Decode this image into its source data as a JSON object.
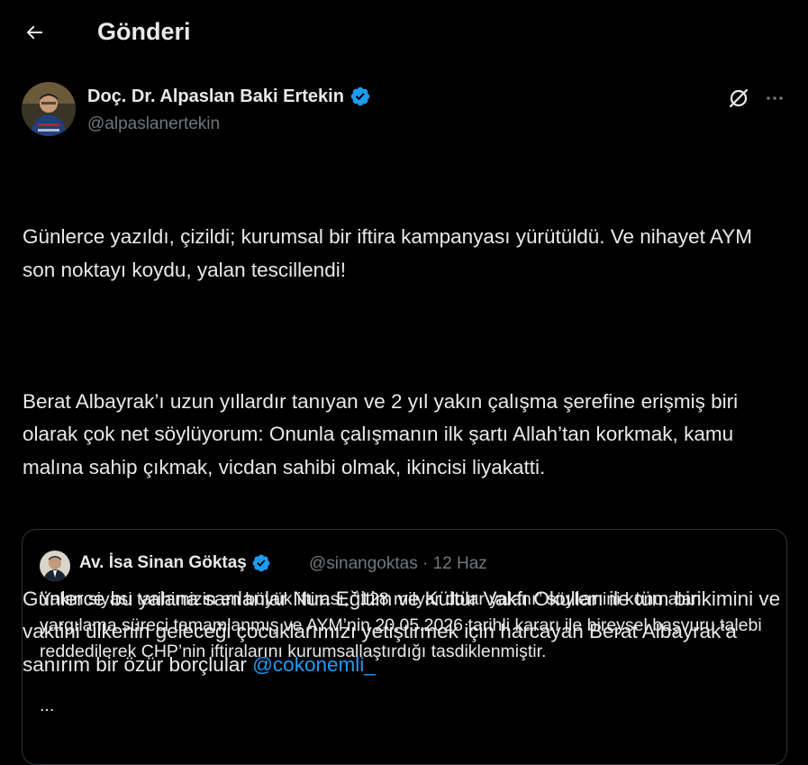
{
  "header": {
    "title": "Gönderi",
    "back_icon": "arrow-left-icon"
  },
  "author": {
    "name": "Doç. Dr. Alpaslan Baki Ertekin",
    "handle": "@alpaslanertekin",
    "verified": true
  },
  "actions": {
    "grok_icon": "grok-icon",
    "more_icon": "more-horizontal-icon"
  },
  "tweet": {
    "paragraphs": [
      "Günlerce yazıldı, çizildi; kurumsal bir iftira kampanyası yürütüldü. Ve nihayet AYM son noktayı koydu, yalan tescillendi!",
      "Berat Albayrak’ı uzun yıllardır tanıyan ve 2 yıl yakın çalışma şerefine erişmiş biri olarak çok net söylüyorum: Onunla çalışmanın ilk şartı Allah’tan korkmak, kamu malına sahip çıkmak, vicdan sahibi olmak, ikincisi liyakatti.",
      "Günlerce bu yalana sarılanlar Nun Eğitim ve Kültür Vakfı Okulları ile tüm birikimini ve vaktini ülkenin geleceği çocuklarımızı yetiştirmek için harcayan Berat Albayrak’a sanırım bir özür borçlular "
    ],
    "mention": "@cokonemli_"
  },
  "quote": {
    "name": "Av. İsa Sinan Göktaş",
    "handle": "@sinangoktas",
    "separator": "·",
    "date": "12 Haz",
    "text": "Yakın siyasi tarihimizin en büyük iftirası, “128 milyar dolar yalanı” söylemini konu alan yargılama süreci tamamlanmış ve AYM’nin 20.05.2026 tarihli kararı ile bireysel başvuru talebi reddedilerek CHP’nin iftiralarını kurumsallaştırdığı tasdiklenmiştir.",
    "ellipsis": "..."
  },
  "colors": {
    "background": "#000000",
    "text": "#e7e9ea",
    "secondary": "#71767b",
    "accent": "#1d9bf0",
    "border": "#2f3336"
  }
}
